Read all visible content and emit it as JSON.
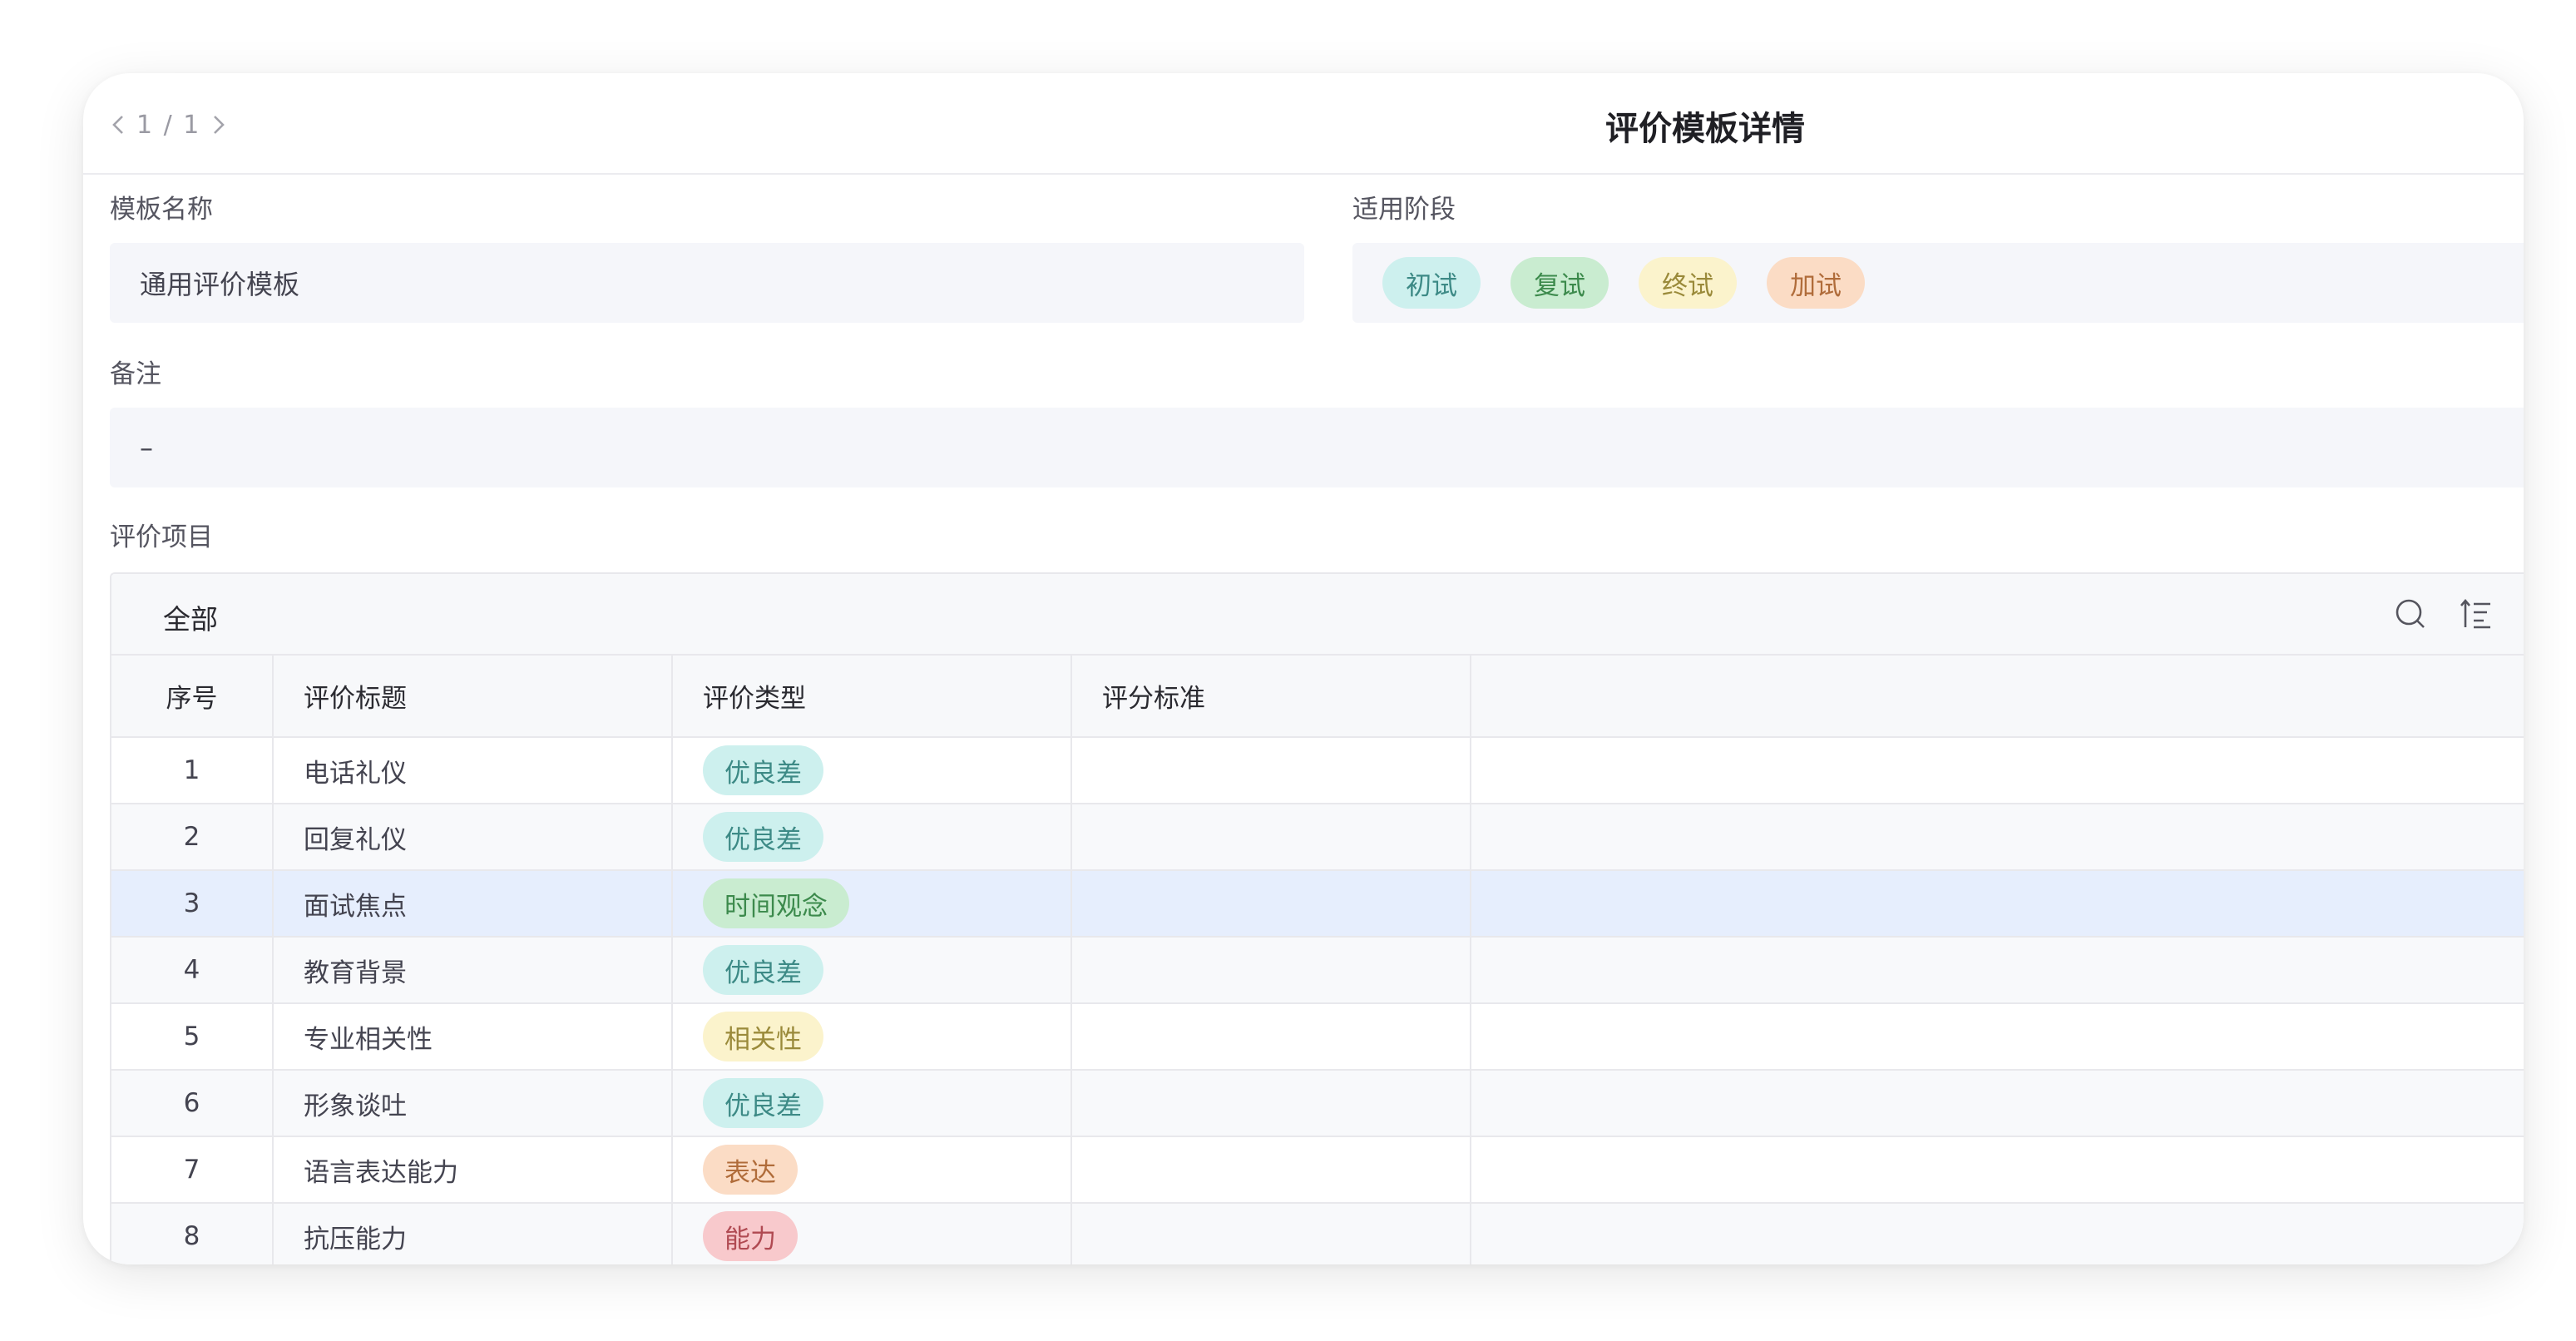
{
  "header": {
    "pager": {
      "prev": "<",
      "current": "1",
      "separator": "/",
      "total": "1",
      "next": ">"
    },
    "title": "评价模板详情"
  },
  "form": {
    "template_name": {
      "label": "模板名称",
      "value": "通用评价模板"
    },
    "stages": {
      "label": "适用阶段",
      "tags": [
        {
          "text": "初试",
          "bg": "#cdf0ee",
          "fg": "#3d8a86"
        },
        {
          "text": "复试",
          "bg": "#c9ecd0",
          "fg": "#3c8a4c"
        },
        {
          "text": "终试",
          "bg": "#fbf3cc",
          "fg": "#9a8a3a"
        },
        {
          "text": "加试",
          "bg": "#fbdcc5",
          "fg": "#b06c3a"
        }
      ]
    },
    "remark": {
      "label": "备注",
      "value": "–"
    },
    "items_label": "评价项目"
  },
  "table": {
    "toolbar": {
      "all_label": "全部",
      "icons": [
        "search-icon",
        "sort-icon"
      ]
    },
    "columns": [
      "序号",
      "评价标题",
      "评价类型",
      "评分标准",
      ""
    ],
    "rows": [
      {
        "no": "1",
        "title": "电话礼仪",
        "type": "优良差",
        "type_bg": "#cdf0ee",
        "type_fg": "#3d8a86",
        "standard": ""
      },
      {
        "no": "2",
        "title": "回复礼仪",
        "type": "优良差",
        "type_bg": "#cdf0ee",
        "type_fg": "#3d8a86",
        "standard": ""
      },
      {
        "no": "3",
        "title": "面试焦点",
        "type": "时间观念",
        "type_bg": "#c9ecd0",
        "type_fg": "#3c8a4c",
        "standard": ""
      },
      {
        "no": "4",
        "title": "教育背景",
        "type": "优良差",
        "type_bg": "#cdf0ee",
        "type_fg": "#3d8a86",
        "standard": ""
      },
      {
        "no": "5",
        "title": "专业相关性",
        "type": "相关性",
        "type_bg": "#fbf3cc",
        "type_fg": "#9a8a3a",
        "standard": ""
      },
      {
        "no": "6",
        "title": "形象谈吐",
        "type": "优良差",
        "type_bg": "#cdf0ee",
        "type_fg": "#3d8a86",
        "standard": ""
      },
      {
        "no": "7",
        "title": "语言表达能力",
        "type": "表达",
        "type_bg": "#fbdcc5",
        "type_fg": "#b06c3a",
        "standard": ""
      },
      {
        "no": "8",
        "title": "抗压能力",
        "type": "能力",
        "type_bg": "#f8c9cc",
        "type_fg": "#b04a52",
        "standard": ""
      }
    ],
    "selected_row": "3"
  },
  "colors": {
    "selected_row_bg": "#e6eefd",
    "field_bg": "#f5f6fa"
  }
}
